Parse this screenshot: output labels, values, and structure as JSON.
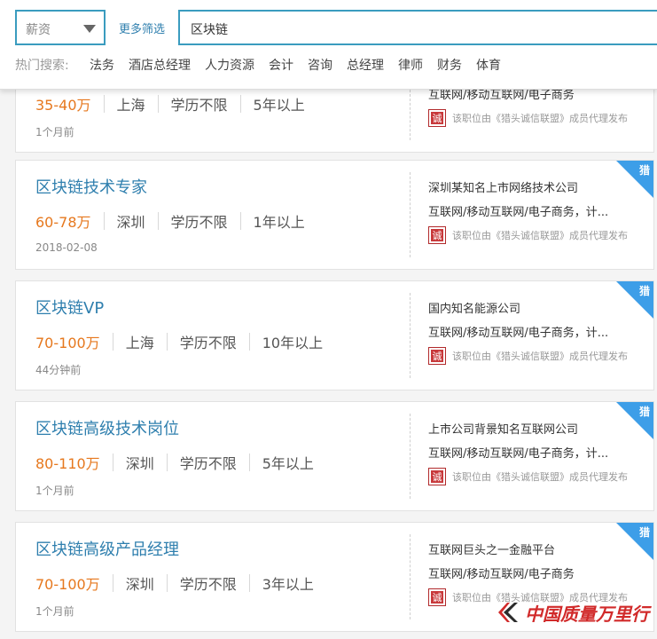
{
  "search": {
    "salary_select_value": "薪资",
    "more_filter_label": "更多筛选",
    "keyword_value": "区块链",
    "hot_label": "热门搜索:",
    "hot_items": [
      "法务",
      "酒店总经理",
      "人力资源",
      "会计",
      "咨询",
      "总经理",
      "律师",
      "财务",
      "体育"
    ]
  },
  "jobs": [
    {
      "title": "",
      "salary": "35-40万",
      "city": "上海",
      "education": "学历不限",
      "experience": "5年以上",
      "time": "1个月前",
      "company": "",
      "industry": "互联网/移动互联网/电子商务",
      "agent_seal": "诚",
      "agent_text": "该职位由《猎头诚信联盟》成员代理发布",
      "corner_badge": ""
    },
    {
      "title": "区块链技术专家",
      "salary": "60-78万",
      "city": "深圳",
      "education": "学历不限",
      "experience": "1年以上",
      "time": "2018-02-08",
      "company": "深圳某知名上市网络技术公司",
      "industry": "互联网/移动互联网/电子商务，计...",
      "agent_seal": "诚",
      "agent_text": "该职位由《猎头诚信联盟》成员代理发布",
      "corner_badge": "猎"
    },
    {
      "title": "区块链VP",
      "salary": "70-100万",
      "city": "上海",
      "education": "学历不限",
      "experience": "10年以上",
      "time": "44分钟前",
      "company": "国内知名能源公司",
      "industry": "互联网/移动互联网/电子商务，计...",
      "agent_seal": "诚",
      "agent_text": "该职位由《猎头诚信联盟》成员代理发布",
      "corner_badge": "猎"
    },
    {
      "title": "区块链高级技术岗位",
      "salary": "80-110万",
      "city": "深圳",
      "education": "学历不限",
      "experience": "5年以上",
      "time": "1个月前",
      "company": "上市公司背景知名互联网公司",
      "industry": "互联网/移动互联网/电子商务，计...",
      "agent_seal": "诚",
      "agent_text": "该职位由《猎头诚信联盟》成员代理发布",
      "corner_badge": "猎"
    },
    {
      "title": "区块链高级产品经理",
      "salary": "70-100万",
      "city": "深圳",
      "education": "学历不限",
      "experience": "3年以上",
      "time": "1个月前",
      "company": "互联网巨头之一金融平台",
      "industry": "互联网/移动互联网/电子商务",
      "agent_seal": "诚",
      "agent_text": "该职位由《猎头诚信联盟》成员代理发布",
      "corner_badge": "猎"
    }
  ],
  "watermark": {
    "brand": "中国质量万里行"
  },
  "icons": {
    "dropdown": "chevron-down-icon",
    "seal": "credit-seal-icon",
    "watermark_logo": "brand-logo-icon"
  },
  "colors": {
    "accent_blue": "#2f7fae",
    "salary_orange": "#e6781e",
    "badge_blue": "#3d9ee8",
    "seal_red": "#c8393b",
    "watermark_red": "#d12a2a"
  }
}
